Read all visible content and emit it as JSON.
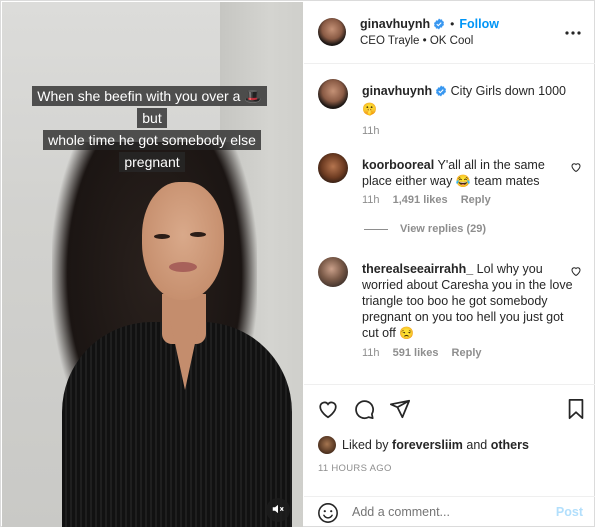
{
  "media": {
    "caption_line1": "When she beefin with you over a 🎩 but",
    "caption_line2": "whole time he got somebody else pregnant",
    "mute_icon": "speaker-muted-icon"
  },
  "header": {
    "username": "ginavhuynh",
    "dot": "•",
    "follow_label": "Follow",
    "subtitle": "CEO Trayle • OK Cool",
    "more_icon": "more-horizontal-icon"
  },
  "comments": [
    {
      "username": "ginavhuynh",
      "verified": true,
      "text": "City Girls down 1000",
      "emoji": "🤫",
      "time": "11h"
    },
    {
      "username": "koorbooreal",
      "text": "Y'all all in the same place either way",
      "emoji": "😂",
      "text_after": "team mates",
      "time": "11h",
      "likes": "1,491 likes",
      "reply": "Reply",
      "view_replies": "View replies (29)"
    },
    {
      "username": "therealseeairrahh_",
      "text": "Lol why you worried about Caresha you in the love triangle too boo he got somebody pregnant on you too hell you just got cut off",
      "emoji": "😒",
      "time": "11h",
      "likes": "591 likes",
      "reply": "Reply"
    }
  ],
  "actions": {
    "liked_prefix": "Liked by",
    "liked_user": "foreversliim",
    "liked_and": "and",
    "liked_others": "others",
    "timestamp": "11 HOURS AGO"
  },
  "add_comment": {
    "placeholder": "Add a comment...",
    "post_label": "Post"
  },
  "colors": {
    "link_blue": "#0095f6",
    "verified_blue": "#3897f0",
    "post_disabled": "#b2dffc",
    "muted_gray": "#8e8e8e"
  }
}
